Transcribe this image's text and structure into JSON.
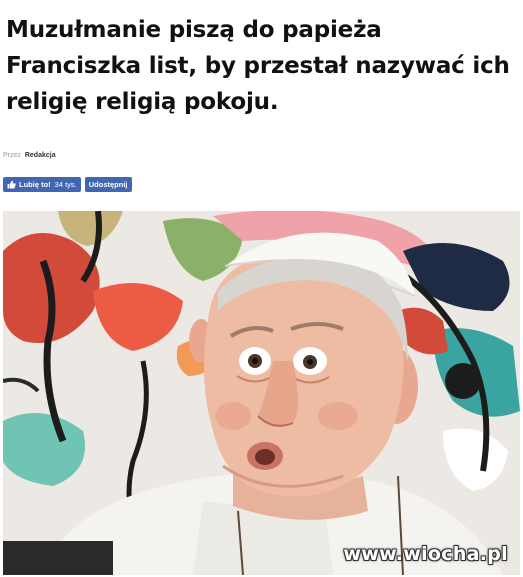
{
  "article": {
    "headline": "Muzułmanie piszą do papieża Franciszka list, by przestał nazywać ich religię religią pokoju.",
    "byline_prefix": "Przez",
    "byline_author": "Redakcja"
  },
  "social": {
    "like_label": "Lubię to!",
    "like_count": "34 tys.",
    "share_label": "Udostępnij"
  },
  "photo": {
    "watermark": "www.wiocha.pl"
  },
  "colors": {
    "facebook_blue": "#4267b2",
    "headline_text": "#111111"
  },
  "icons": {
    "like": "thumbs-up-icon"
  }
}
